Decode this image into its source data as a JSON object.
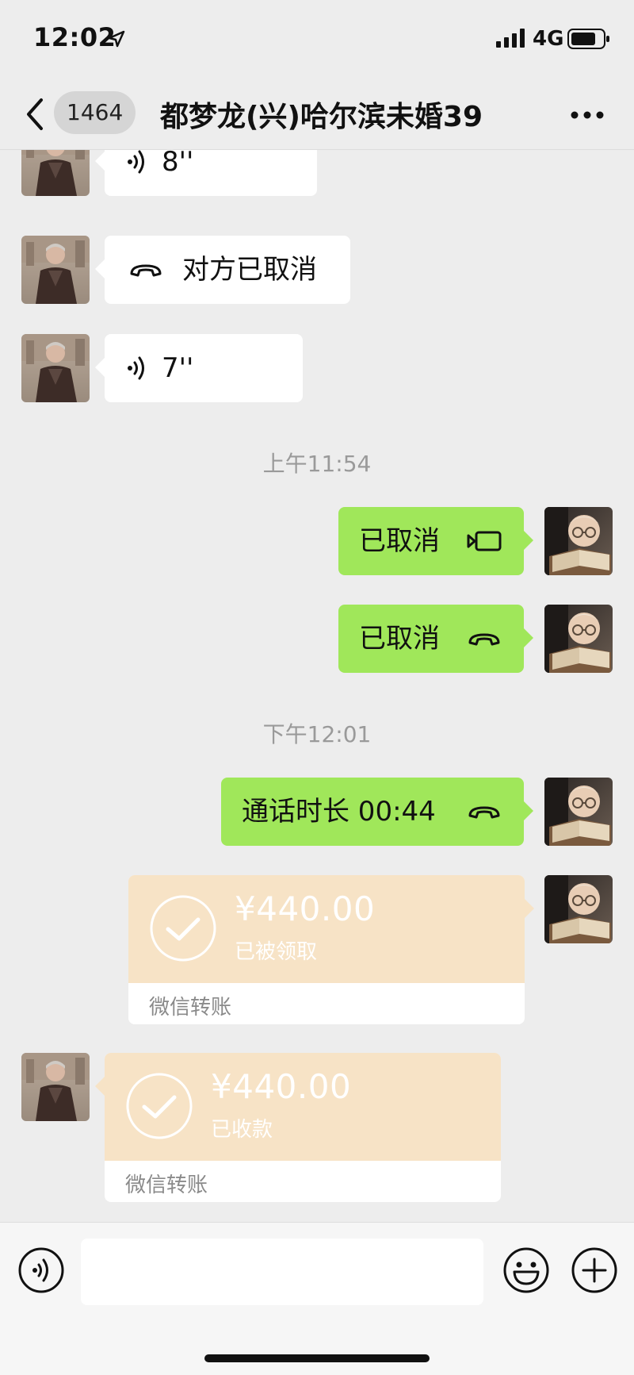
{
  "status": {
    "time": "12:02",
    "network": "4G",
    "location_icon": "location-arrow-icon",
    "signal_icon": "signal-bars-icon",
    "battery_icon": "battery-icon"
  },
  "nav": {
    "unread_count": "1464",
    "title": "都梦龙(兴)哈尔滨未婚39",
    "back_icon": "chevron-left-icon",
    "more_icon": "more-dots-icon"
  },
  "messages": [
    {
      "side": "in",
      "type": "voice",
      "text": "8''"
    },
    {
      "side": "in",
      "type": "call",
      "text": "对方已取消"
    },
    {
      "side": "in",
      "type": "voice",
      "text": "7''"
    },
    {
      "side": "out",
      "type": "video-call",
      "text": "已取消"
    },
    {
      "side": "out",
      "type": "call",
      "text": "已取消"
    },
    {
      "side": "out",
      "type": "call",
      "text": "通话时长 00:44"
    }
  ],
  "timestamps": [
    "上午11:54",
    "下午12:01"
  ],
  "transfers": [
    {
      "side": "out",
      "amount": "¥440.00",
      "status": "已被领取",
      "brand": "微信转账"
    },
    {
      "side": "in",
      "amount": "¥440.00",
      "status": "已收款",
      "brand": "微信转账"
    }
  ],
  "colors": {
    "background": "#ededed",
    "incoming_bubble": "#ffffff",
    "outgoing_bubble": "#a0e75a",
    "transfer_card": "#f7e3c6",
    "timestamp_text": "#9a9a9a"
  },
  "input_bar": {
    "placeholder": "",
    "voice_icon": "voice-input-icon",
    "emoji_icon": "emoji-icon",
    "plus_icon": "plus-circle-icon"
  }
}
